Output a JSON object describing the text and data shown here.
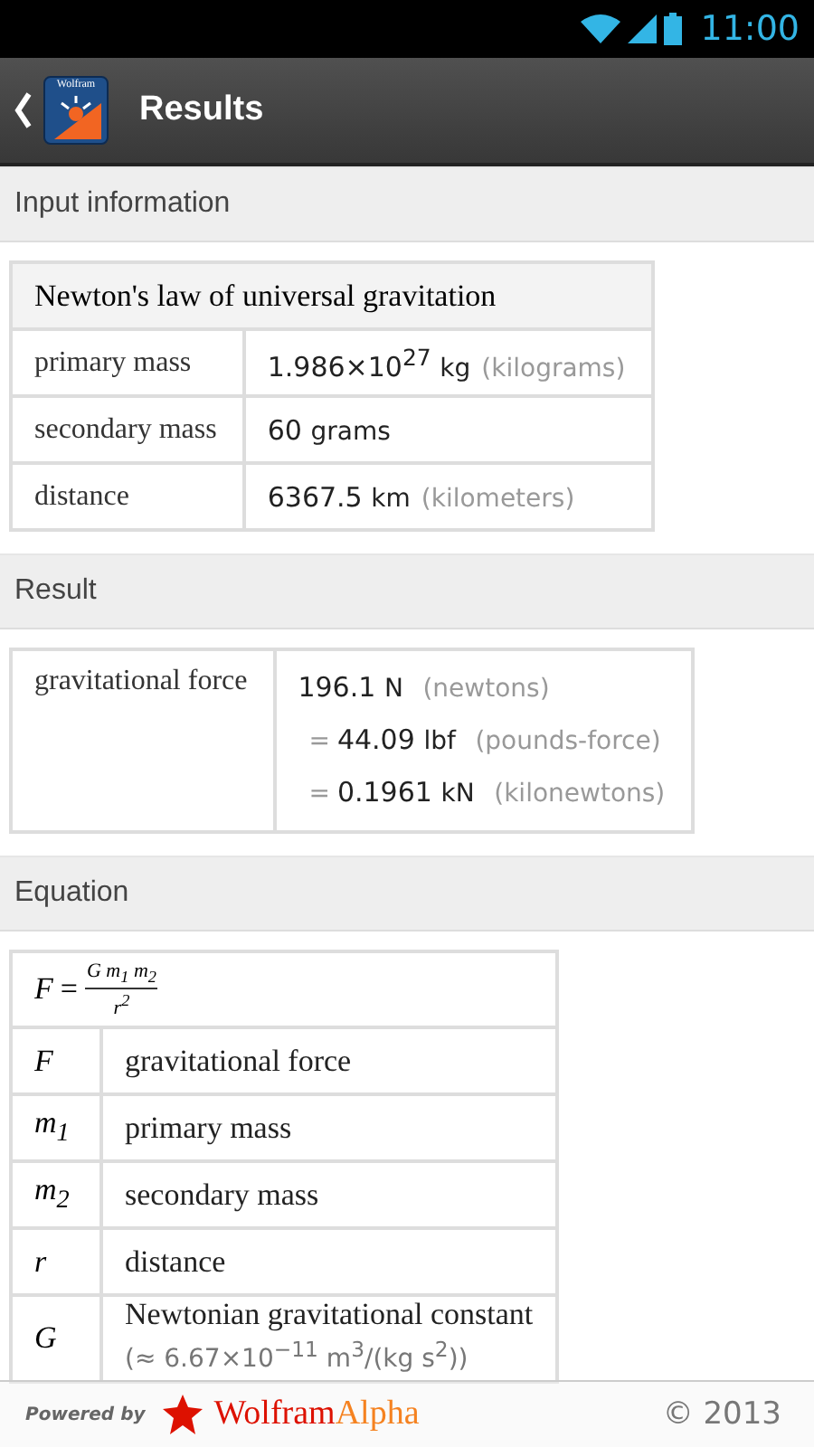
{
  "status_bar": {
    "time": "11:00"
  },
  "action_bar": {
    "app_icon_text": "Wolfram",
    "title": "Results"
  },
  "input_section": {
    "heading": "Input information",
    "table_title": "Newton's law of universal gravitation",
    "rows": [
      {
        "label": "primary mass",
        "number": "1.986×10$^{27}$",
        "unit": "kg",
        "note": "(kilograms)"
      },
      {
        "label": "secondary mass",
        "number": "60",
        "unit": "grams"
      },
      {
        "label": "distance",
        "number": "6367.5",
        "unit": "km",
        "note": "(kilometers)"
      }
    ]
  },
  "result_section": {
    "heading": "Result",
    "label": "gravitational force",
    "values": [
      {
        "number": "196.1",
        "unit": "N",
        "note": "(newtons)"
      },
      {
        "prefix": "=",
        "number": "44.09",
        "unit": "lbf",
        "note": "(pounds-force)"
      },
      {
        "prefix": "=",
        "number": "0.1961",
        "unit": "kN",
        "note": "(kilonewtons)"
      }
    ]
  },
  "equation_section": {
    "heading": "Equation",
    "formula": {
      "lhs": "F",
      "relation": "=",
      "numerator": "G m$_{1}$ m$_{2}$",
      "denominator": "r$^{2}$"
    },
    "variables": [
      {
        "symbol": "F",
        "meaning": "gravitational force"
      },
      {
        "symbol": "m$_{1}$",
        "meaning": "primary mass"
      },
      {
        "symbol": "m$_{2}$",
        "meaning": "secondary mass"
      },
      {
        "symbol": "r",
        "meaning": "distance"
      },
      {
        "symbol": "G",
        "meaning": "Newtonian gravitational constant",
        "detail": "(≈ 6.67×10$^{−11}$ m$^{3}$/(kg s$^{2}$))"
      }
    ]
  },
  "footer": {
    "powered_by": "Powered by",
    "brand_first": "Wolfram",
    "brand_second": "Alpha",
    "copyright": "© 2013"
  }
}
